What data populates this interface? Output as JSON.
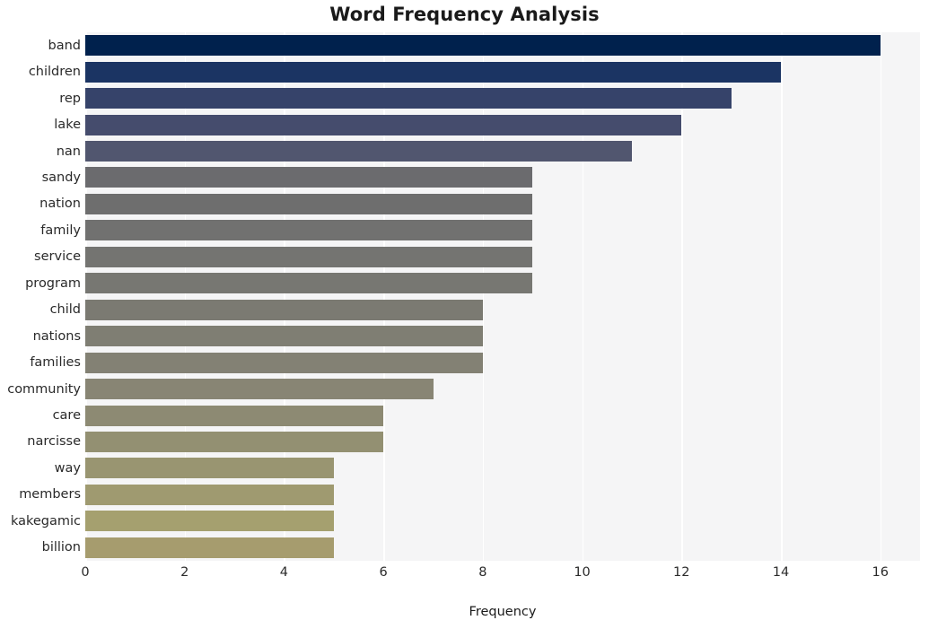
{
  "chart_data": {
    "type": "bar",
    "orientation": "horizontal",
    "title": "Word Frequency Analysis",
    "xlabel": "Frequency",
    "ylabel": "",
    "xlim": [
      0,
      16.8
    ],
    "xticks": [
      0,
      2,
      4,
      6,
      8,
      10,
      12,
      14,
      16
    ],
    "xtick_labels": [
      "0",
      "2",
      "4",
      "6",
      "8",
      "10",
      "12",
      "14",
      "16"
    ],
    "grid": "vertical-white-on-light",
    "legend": "none",
    "categories": [
      "band",
      "children",
      "rep",
      "lake",
      "nan",
      "sandy",
      "nation",
      "family",
      "service",
      "program",
      "child",
      "nations",
      "families",
      "community",
      "care",
      "narcisse",
      "way",
      "members",
      "kakegamic",
      "billion"
    ],
    "values": [
      16,
      14,
      13,
      12,
      11,
      9,
      9,
      9,
      9,
      9,
      8,
      8,
      8,
      7,
      6,
      6,
      5,
      5,
      5,
      5
    ],
    "bar_colors": [
      "#00214d",
      "#1b3463",
      "#36436a",
      "#454c6d",
      "#51566f",
      "#6b6b6e",
      "#6e6e6e",
      "#717170",
      "#747471",
      "#777772",
      "#7b7a72",
      "#7f7e73",
      "#838174",
      "#888574",
      "#8d8a73",
      "#939072",
      "#999571",
      "#9f9a70",
      "#a5a06f",
      "#a69c6e"
    ],
    "colormap": "cividis",
    "plot_background": "#f5f5f6",
    "figure_background": "#ffffff",
    "gridline_color": "#ffffff",
    "title_color": "#1a1a1a",
    "tick_label_color": "#2a2a2a"
  }
}
